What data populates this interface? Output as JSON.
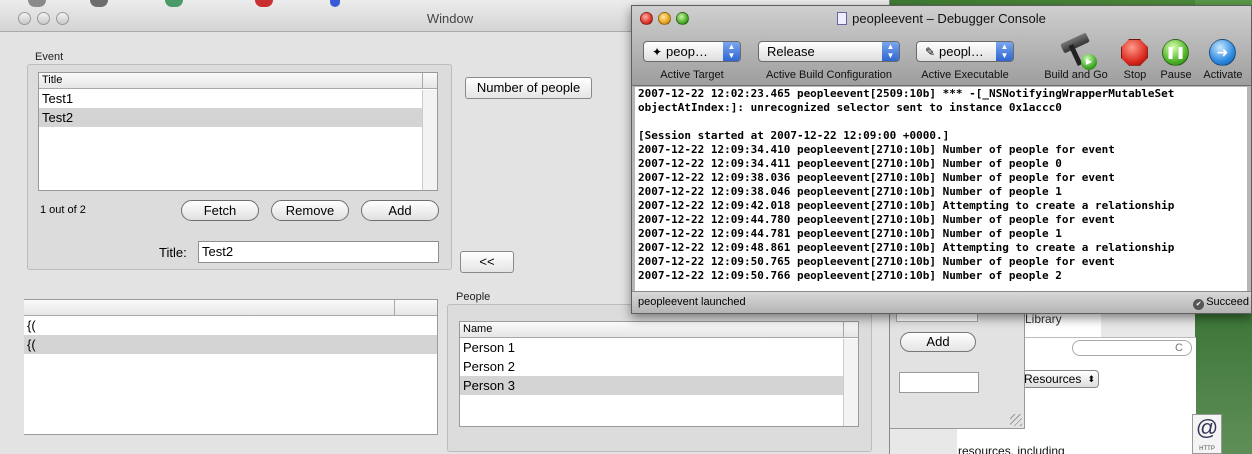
{
  "main_window": {
    "title": "Window",
    "event_group": {
      "label": "Event",
      "table": {
        "column": "Title",
        "rows": [
          "Test1",
          "Test2"
        ],
        "selected_index": 1
      },
      "count_label": "1 out of 2",
      "buttons": {
        "fetch": "Fetch",
        "remove": "Remove",
        "add": "Add"
      },
      "title_label": "Title:",
      "title_value": "Test2"
    },
    "number_of_people_button": "Number of people",
    "back_button": "<<",
    "lower_table": {
      "rows": [
        "{(",
        "{("
      ],
      "selected_index": 1
    },
    "people_group": {
      "label": "People",
      "table": {
        "column": "Name",
        "rows": [
          "Person 1",
          "Person 2",
          "Person 3"
        ],
        "selected_index": 2
      }
    }
  },
  "middle_window": {
    "add_button": "Add"
  },
  "background_window": {
    "library_label": "Library",
    "search_placeholder": "C",
    "resources_popup": "Resources",
    "resources_text": "resources, including",
    "at_icon": "@",
    "at_icon_caption": "HTTP"
  },
  "debugger": {
    "title": "peopleevent – Debugger Console",
    "toolbar": {
      "active_target": {
        "value": "peop…",
        "caption": "Active Target"
      },
      "build_config": {
        "value": "Release",
        "caption": "Active Build Configuration"
      },
      "active_executable": {
        "value": "peopl…",
        "caption": "Active Executable"
      },
      "build_and_go": "Build and Go",
      "stop": "Stop",
      "pause": "Pause",
      "activate": "Activate"
    },
    "console_lines": [
      "2007-12-22 12:02:23.465 peopleevent[2509:10b] *** -[_NSNotifyingWrapperMutableSet",
      "objectAtIndex:]: unrecognized selector sent to instance 0x1accc0",
      "",
      "[Session started at 2007-12-22 12:09:00 +0000.]",
      "2007-12-22 12:09:34.410 peopleevent[2710:10b] Number of people for event",
      "2007-12-22 12:09:34.411 peopleevent[2710:10b] Number of people 0",
      "2007-12-22 12:09:38.036 peopleevent[2710:10b] Number of people for event",
      "2007-12-22 12:09:38.046 peopleevent[2710:10b] Number of people 1",
      "2007-12-22 12:09:42.018 peopleevent[2710:10b] Attempting to create a relationship",
      "2007-12-22 12:09:44.780 peopleevent[2710:10b] Number of people for event",
      "2007-12-22 12:09:44.781 peopleevent[2710:10b] Number of people 1",
      "2007-12-22 12:09:48.861 peopleevent[2710:10b] Attempting to create a relationship",
      "2007-12-22 12:09:50.765 peopleevent[2710:10b] Number of people for event",
      "2007-12-22 12:09:50.766 peopleevent[2710:10b] Number of people 2"
    ],
    "status_left": "peopleevent launched",
    "status_right": "Succeed"
  }
}
